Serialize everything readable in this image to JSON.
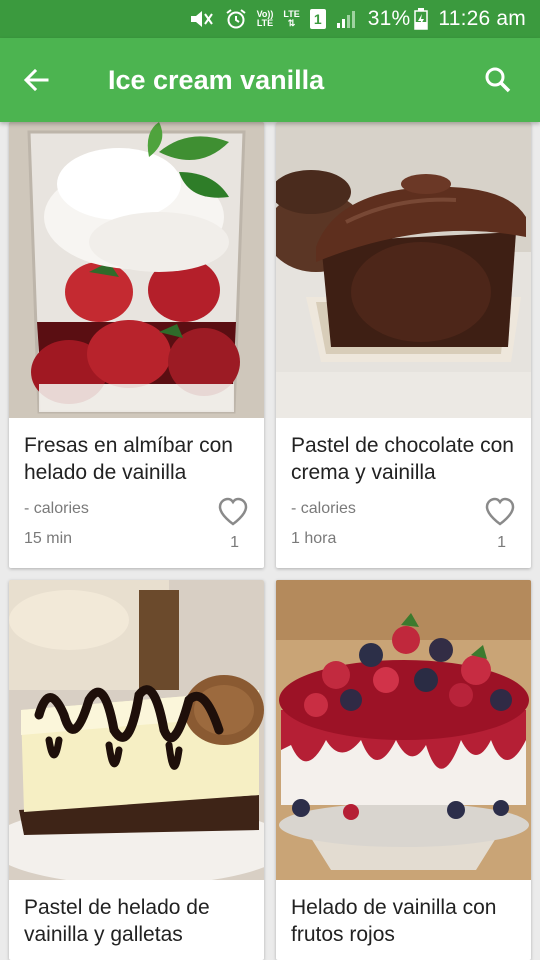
{
  "status_bar": {
    "battery": "31%",
    "time": "11:26 am",
    "icons": [
      "mute-icon",
      "alarm-icon",
      "volte-icon",
      "lte-icon",
      "sim-icon",
      "signal-icon",
      "battery-icon"
    ],
    "volte_top": "Vo))",
    "volte_bottom": "LTE",
    "lte_label": "LTE",
    "sim_label": "1"
  },
  "app_bar": {
    "title": "Ice cream vanilla",
    "color": "#4cb450",
    "status_color": "#3b9a3e"
  },
  "recipes": [
    {
      "title": "Fresas en almíbar con helado de vainilla",
      "calories": "- calories",
      "time": "15 min",
      "likes": "1"
    },
    {
      "title": "Pastel de chocolate con crema y vainilla",
      "calories": "- calories",
      "time": "1 hora",
      "likes": "1"
    },
    {
      "title": "Pastel de helado de vainilla y galletas"
    },
    {
      "title": "Helado de vainilla con frutos rojos"
    }
  ]
}
